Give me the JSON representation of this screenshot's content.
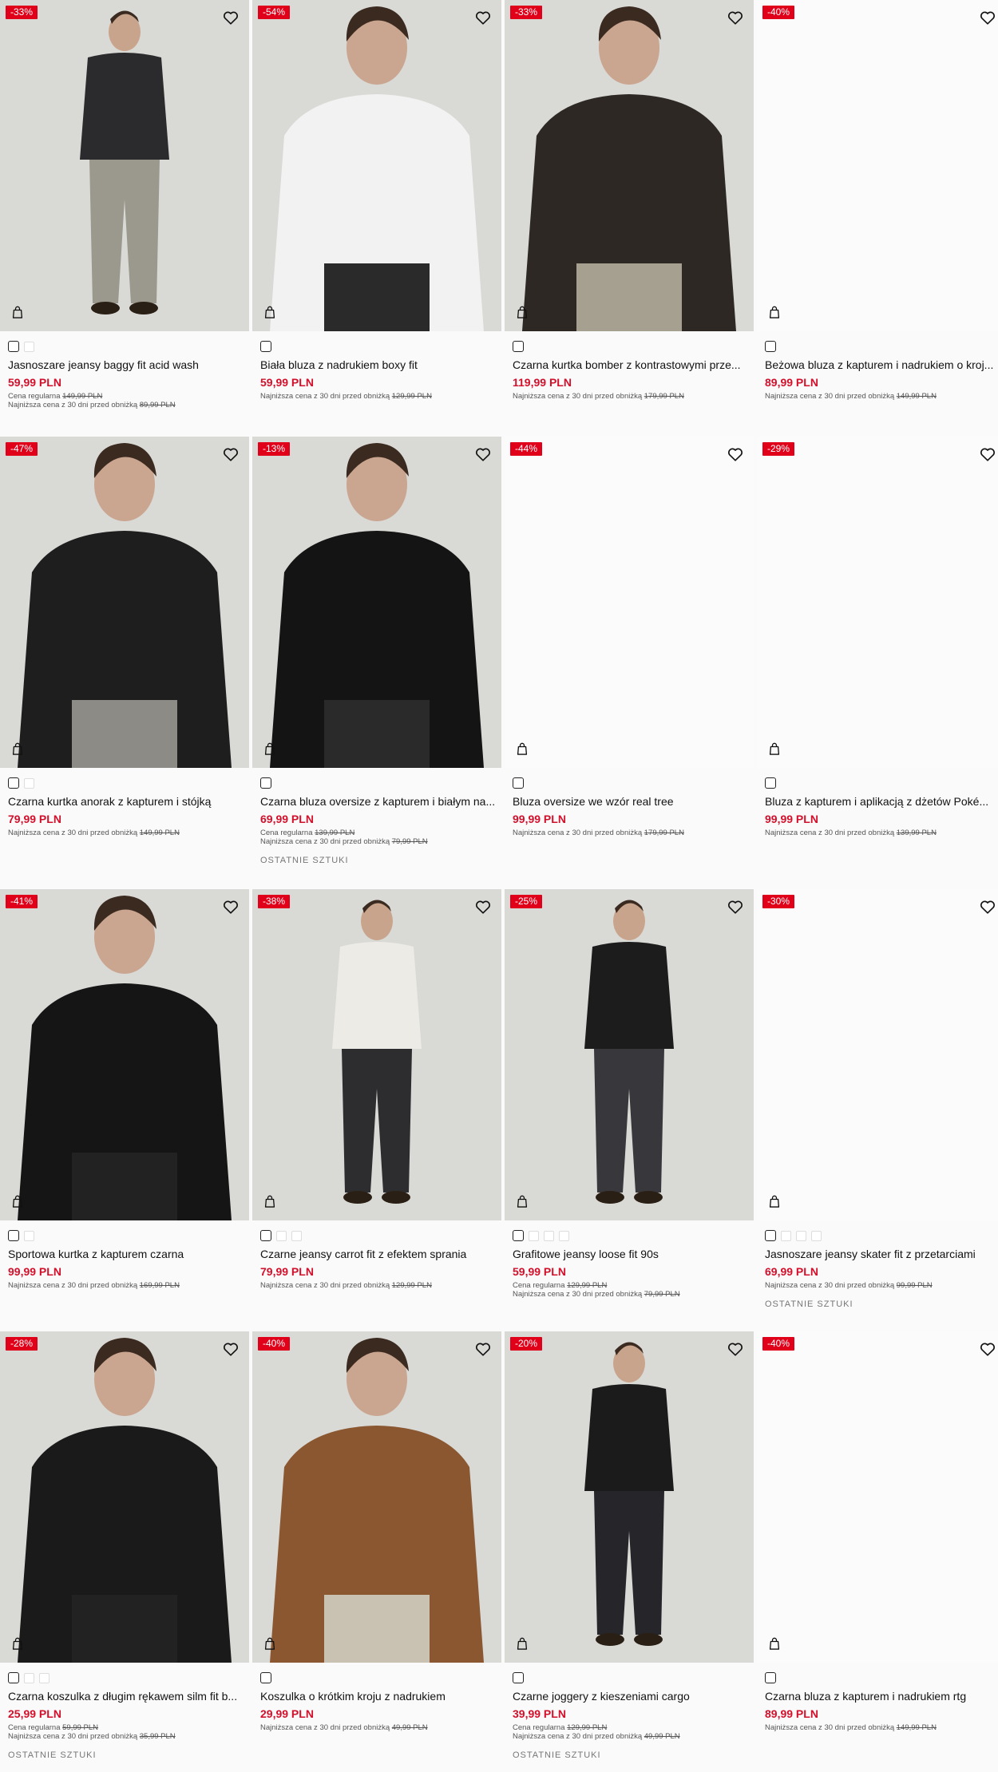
{
  "products": [
    {
      "badge": "-33%",
      "title": "Jasnoszare jeansy baggy fit acid wash",
      "price": "59,99 PLN",
      "regular_label": "Cena regularna",
      "regular_price": "149,99 PLN",
      "lowest_label": "Najniższa cena z 30 dni przed obniżką",
      "lowest_price": "89,99 PLN",
      "last_items": "",
      "swatches": 2,
      "photo": "grey-jeans-hoodie"
    },
    {
      "badge": "-54%",
      "title": "Biała bluza z nadrukiem boxy fit",
      "price": "59,99 PLN",
      "regular_label": "",
      "regular_price": "",
      "lowest_label": "Najniższa cena z 30 dni przed obniżką",
      "lowest_price": "129,99 PLN",
      "last_items": "",
      "swatches": 1,
      "photo": "white-sweatshirt"
    },
    {
      "badge": "-33%",
      "title": "Czarna kurtka bomber z kontrastowymi prze...",
      "price": "119,99 PLN",
      "regular_label": "",
      "regular_price": "",
      "lowest_label": "Najniższa cena z 30 dni przed obniżką",
      "lowest_price": "179,99 PLN",
      "last_items": "",
      "swatches": 1,
      "photo": "leather-bomber"
    },
    {
      "badge": "-40%",
      "title": "Beżowa bluza z kapturem i nadrukiem o kroj...",
      "price": "89,99 PLN",
      "regular_label": "",
      "regular_price": "",
      "lowest_label": "Najniższa cena z 30 dni przed obniżką",
      "lowest_price": "149,99 PLN",
      "last_items": "",
      "swatches": 1,
      "photo": "blank"
    },
    {
      "badge": "-47%",
      "title": "Czarna kurtka anorak z kapturem i stójką",
      "price": "79,99 PLN",
      "regular_label": "",
      "regular_price": "",
      "lowest_label": "Najniższa cena z 30 dni przed obniżką",
      "lowest_price": "149,99 PLN",
      "last_items": "",
      "swatches": 2,
      "photo": "black-anorak"
    },
    {
      "badge": "-13%",
      "title": "Czarna bluza oversize z kapturem i białym na...",
      "price": "69,99 PLN",
      "regular_label": "Cena regularna",
      "regular_price": "139,99 PLN",
      "lowest_label": "Najniższa cena z 30 dni przed obniżką",
      "lowest_price": "79,99 PLN",
      "last_items": "OSTATNIE SZTUKI",
      "swatches": 1,
      "photo": "black-hoodie-print"
    },
    {
      "badge": "-44%",
      "title": "Bluza oversize we wzór real tree",
      "price": "99,99 PLN",
      "regular_label": "",
      "regular_price": "",
      "lowest_label": "Najniższa cena z 30 dni przed obniżką",
      "lowest_price": "179,99 PLN",
      "last_items": "",
      "swatches": 1,
      "photo": "blank"
    },
    {
      "badge": "-29%",
      "title": "Bluza z kapturem i aplikacją z dżetów Poké...",
      "price": "99,99 PLN",
      "regular_label": "",
      "regular_price": "",
      "lowest_label": "Najniższa cena z 30 dni przed obniżką",
      "lowest_price": "139,99 PLN",
      "last_items": "",
      "swatches": 1,
      "photo": "blank"
    },
    {
      "badge": "-41%",
      "title": "Sportowa kurtka z kapturem czarna",
      "price": "99,99 PLN",
      "regular_label": "",
      "regular_price": "",
      "lowest_label": "Najniższa cena z 30 dni przed obniżką",
      "lowest_price": "169,99 PLN",
      "last_items": "",
      "swatches": 2,
      "photo": "black-hooded-jacket"
    },
    {
      "badge": "-38%",
      "title": "Czarne jeansy carrot fit z efektem sprania",
      "price": "79,99 PLN",
      "regular_label": "",
      "regular_price": "",
      "lowest_label": "Najniższa cena z 30 dni przed obniżką",
      "lowest_price": "129,99 PLN",
      "last_items": "",
      "swatches": 3,
      "photo": "carrot-jeans"
    },
    {
      "badge": "-25%",
      "title": "Grafitowe jeansy loose fit 90s",
      "price": "59,99 PLN",
      "regular_label": "Cena regularna",
      "regular_price": "129,99 PLN",
      "lowest_label": "Najniższa cena z 30 dni przed obniżką",
      "lowest_price": "79,99 PLN",
      "last_items": "",
      "swatches": 4,
      "photo": "loose-jeans"
    },
    {
      "badge": "-30%",
      "title": "Jasnoszare jeansy skater fit z przetarciami",
      "price": "69,99 PLN",
      "regular_label": "",
      "regular_price": "",
      "lowest_label": "Najniższa cena z 30 dni przed obniżką",
      "lowest_price": "99,99 PLN",
      "last_items": "OSTATNIE SZTUKI",
      "swatches": 4,
      "photo": "blank"
    },
    {
      "badge": "-28%",
      "title": "Czarna koszulka z długim rękawem silm fit b...",
      "price": "25,99 PLN",
      "regular_label": "Cena regularna",
      "regular_price": "59,99 PLN",
      "lowest_label": "Najniższa cena z 30 dni przed obniżką",
      "lowest_price": "35,99 PLN",
      "last_items": "OSTATNIE SZTUKI",
      "swatches": 3,
      "photo": "black-longsleeve"
    },
    {
      "badge": "-40%",
      "title": "Koszulka o krótkim kroju z nadrukiem",
      "price": "29,99 PLN",
      "regular_label": "",
      "regular_price": "",
      "lowest_label": "Najniższa cena z 30 dni przed obniżką",
      "lowest_price": "49,99 PLN",
      "last_items": "",
      "swatches": 1,
      "photo": "brown-tee"
    },
    {
      "badge": "-20%",
      "title": "Czarne joggery z kieszeniami cargo",
      "price": "39,99 PLN",
      "regular_label": "Cena regularna",
      "regular_price": "129,99 PLN",
      "lowest_label": "Najniższa cena z 30 dni przed obniżką",
      "lowest_price": "49,99 PLN",
      "last_items": "OSTATNIE SZTUKI",
      "swatches": 1,
      "photo": "cargo-joggers"
    },
    {
      "badge": "-40%",
      "title": "Czarna bluza z kapturem i nadrukiem rtg",
      "price": "89,99 PLN",
      "regular_label": "",
      "regular_price": "",
      "lowest_label": "Najniższa cena z 30 dni przed obniżką",
      "lowest_price": "149,99 PLN",
      "last_items": "",
      "swatches": 1,
      "photo": "blank"
    }
  ],
  "colors": {
    "sale": "#e1001a",
    "price": "#d3102b"
  },
  "icons": {
    "wishlist": "heart-icon",
    "cart": "shopping-bag-icon"
  }
}
